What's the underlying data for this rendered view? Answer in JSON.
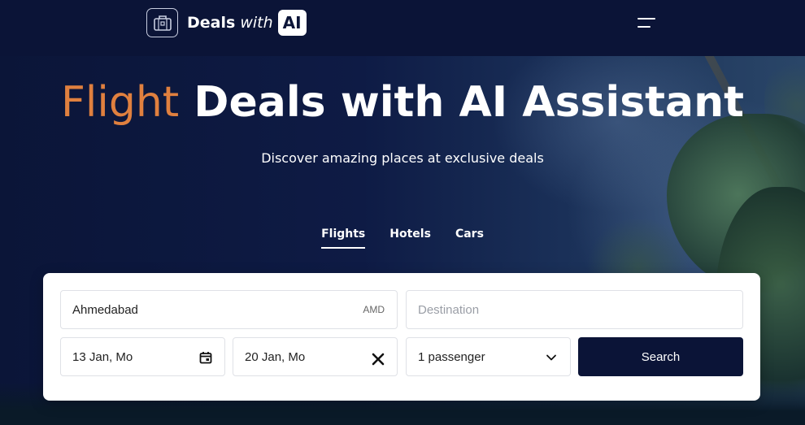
{
  "brand": {
    "name_bold": "Deals",
    "name_italic": "with",
    "name_badge": "AI",
    "logo_icon": "suitcase-icon"
  },
  "nav": {
    "menu_icon": "hamburger-menu-icon"
  },
  "hero": {
    "headline_accent": "Flight",
    "headline_main": "Deals with AI Assistant",
    "subtitle": "Discover amazing places at exclusive deals"
  },
  "tabs": [
    {
      "label": "Flights",
      "active": true
    },
    {
      "label": "Hotels",
      "active": false
    },
    {
      "label": "Cars",
      "active": false
    }
  ],
  "search": {
    "origin": {
      "value": "Ahmedabad",
      "code": "AMD"
    },
    "destination": {
      "value": "",
      "placeholder": "Destination"
    },
    "depart_date": {
      "value": "13 Jan, Mo",
      "icon": "calendar-icon"
    },
    "return_date": {
      "value": "20 Jan, Mo",
      "icon": "close-icon"
    },
    "passengers": {
      "value": "1 passenger",
      "icon": "chevron-down-icon"
    },
    "button_label": "Search"
  },
  "colors": {
    "navy": "#0b1437",
    "accent": "#e0803f",
    "card": "#ffffff"
  }
}
